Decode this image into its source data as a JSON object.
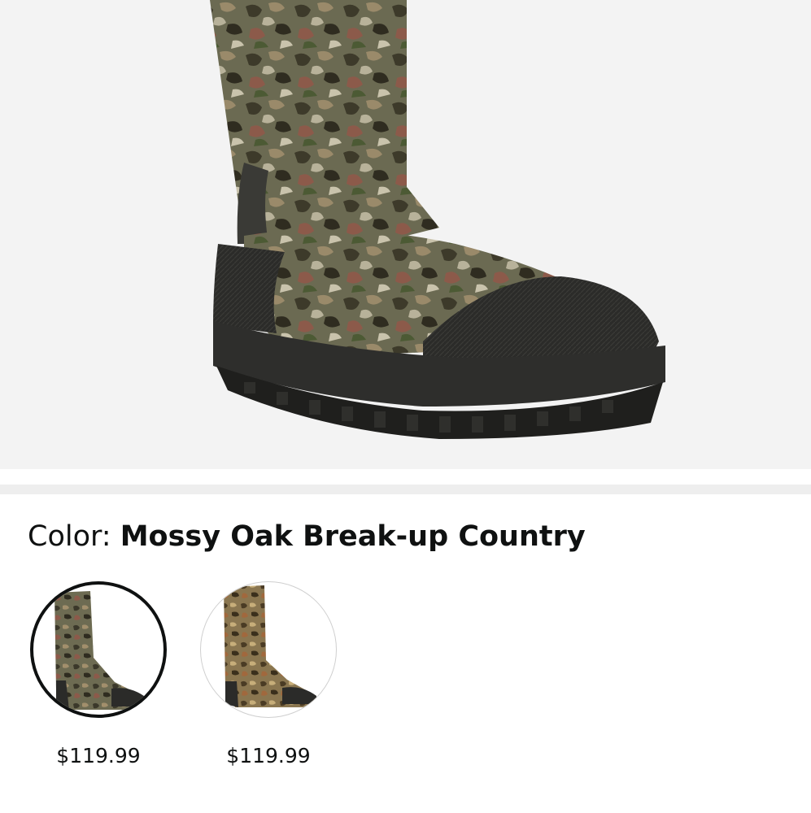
{
  "product_image": {
    "icon": "camo-hunting-boot-image",
    "background": "#f3f3f3"
  },
  "color_selector": {
    "label": "Color:",
    "selected_value": "Mossy Oak Break-up Country",
    "options": [
      {
        "icon": "camo-boot-thumbnail",
        "price": "$119.99",
        "selected": true
      },
      {
        "icon": "camo-boot-thumbnail",
        "price": "$119.99",
        "selected": false
      }
    ]
  },
  "colors": {
    "text": "#0f1111",
    "divider": "#eeeeee",
    "selected_ring": "#0f1111",
    "unselected_ring": "#cfcfcf"
  }
}
